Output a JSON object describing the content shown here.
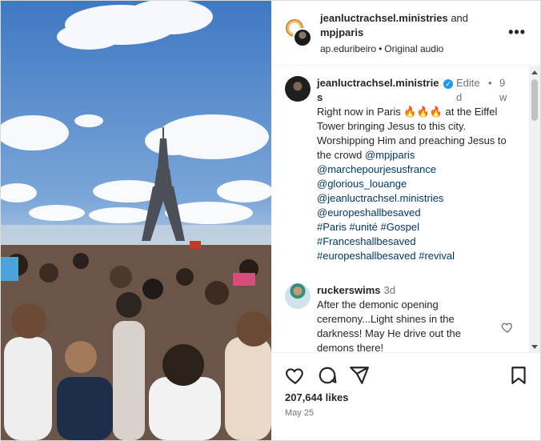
{
  "header": {
    "author_primary": "jeanluctrachsel.ministries",
    "conjunction": "and",
    "author_secondary": "mpjparis",
    "audio_user": "ap.eduribeiro",
    "audio_label": "Original audio",
    "more_glyph": "•••"
  },
  "caption": {
    "username": "jeanluctrachsel.ministries",
    "edited": "Edited",
    "dot": "•",
    "time": "9w",
    "text_prefix": "Right now in Paris 🔥🔥🔥 at the Eiffel Tower bringing Jesus to this city. Worshipping Him and preaching Jesus to the crowd",
    "mentions": [
      "@mpjparis",
      "@marchepourjesusfrance",
      "@glorious_louange",
      "@jeanluctrachsel.ministries",
      "@europeshallbesaved"
    ],
    "hashtags_line1": [
      "#Paris",
      "#unité",
      "#Gospel"
    ],
    "hashtags_line2": [
      "#Franceshallbesaved"
    ],
    "hashtags_line3": [
      "#europeshallbesaved",
      "#revival"
    ]
  },
  "comment": {
    "username": "ruckerswims",
    "time": "3d",
    "text": "After the demonic opening ceremony...Light shines in the darkness! May He drive out the demons there!"
  },
  "actions": {
    "likes": "207,644 likes",
    "date": "May 25"
  },
  "icons": [
    "heart-icon",
    "comment-icon",
    "share-icon",
    "bookmark-icon",
    "verified-badge-icon",
    "more-options-icon"
  ],
  "colors": {
    "text": "#262626",
    "secondary": "#737373",
    "link": "#00376b",
    "verified": "#1d9bf0",
    "border": "#dbdbdb"
  }
}
